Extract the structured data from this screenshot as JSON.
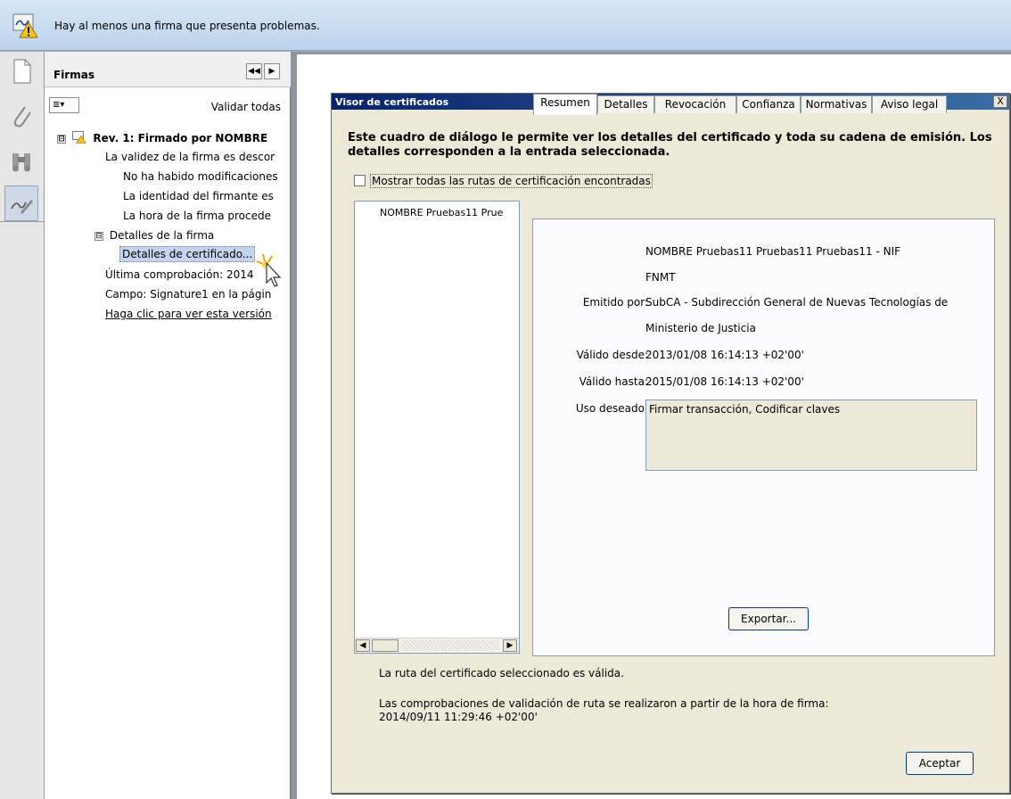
{
  "notification": {
    "icon": "signature-warning-icon",
    "message": "Hay al menos una firma que presenta problemas."
  },
  "left_tools": [
    "pages-icon",
    "attachment-icon",
    "binoculars-icon",
    "signature-pen-icon"
  ],
  "signatures_panel": {
    "title": "Firmas",
    "options_icon": "list-options-icon",
    "validate_all": "Validar todas",
    "tree": [
      {
        "text": "Rev. 1: Firmado por NOMBRE",
        "toggle": "⊟"
      },
      {
        "text": "La validez de la firma es descor"
      },
      {
        "text": "No ha habido modificaciones"
      },
      {
        "text": "La identidad del firmante es"
      },
      {
        "text": "La hora de la firma procede"
      },
      {
        "text": "Detalles de la firma",
        "toggle": "⊟"
      },
      {
        "text": "Detalles de certificado..."
      },
      {
        "text": "Última comprobación: 2014"
      },
      {
        "text": "Campo: Signature1 en la págin"
      },
      {
        "text": "Haga clic para ver esta versión"
      }
    ]
  },
  "dialog": {
    "title": "Visor de certificados",
    "close": "X",
    "intro": "Este cuadro de diálogo le permite ver los detalles del certificado y toda su cadena de emisión. Los detalles corresponden a la entrada seleccionada.",
    "show_all_paths": "Mostrar todas las rutas de certificación encontradas",
    "show_all_paths_checked": false,
    "cert_list": [
      "NOMBRE Pruebas11 Prue"
    ],
    "tabs": [
      "Resumen",
      "Detalles",
      "Revocación",
      "Confianza",
      "Normativas",
      "Aviso legal"
    ],
    "active_tab": "Resumen",
    "summary": {
      "subject_line1": "NOMBRE Pruebas11 Pruebas11 Pruebas11 - NIF",
      "subject_line2": "FNMT",
      "issued_by_label": "Emitido por:",
      "issued_by_line1": "SubCA - Subdirección General de Nuevas Tecnologías de",
      "issued_by_line2": "Ministerio de Justicia",
      "valid_from_label": "Válido desde:",
      "valid_from": "2013/01/08 16:14:13 +02'00'",
      "valid_to_label": "Válido hasta:",
      "valid_to": "2015/01/08 16:14:13 +02'00'",
      "intended_use_label": "Uso deseado:",
      "intended_use": "Firmar transacción, Codificar claves"
    },
    "export_button": "Exportar...",
    "status_valid": "La ruta del certificado seleccionado es válida.",
    "status_check_line1": "Las comprobaciones de validación de ruta se realizaron a partir de la hora de firma:",
    "status_check_line2": "2014/09/11 11:29:46 +02'00'",
    "accept_button": "Aceptar"
  }
}
